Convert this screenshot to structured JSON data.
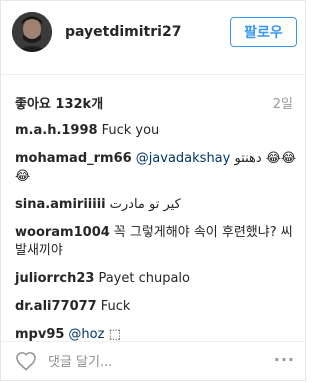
{
  "post": {
    "username": "payetdimitri27",
    "follow_label": "팔로우",
    "likes": "좋아요 132k개",
    "time": "2일"
  },
  "comments": [
    {
      "user": "m.a.h.1998",
      "text": "Fuck you"
    },
    {
      "user": "mohamad_rm66",
      "mention": "@javadakshay",
      "text": " دهنتو 😂😂😂"
    },
    {
      "user": "sina.amiriiiii",
      "text": "کیر تو مادرت"
    },
    {
      "user": "wooram1004",
      "text": "꼭 그렇게해야 속이 후련했냐? 씨발새끼야"
    },
    {
      "user": "juliorrch23",
      "text": "Payet chupalo"
    },
    {
      "user": "dr.ali77077",
      "text": "Fuck"
    },
    {
      "user": "mpv95",
      "mention": "@hoz",
      "text": " ⬚"
    }
  ],
  "footer": {
    "input_placeholder": "댓글 달기...",
    "more_label": "···"
  }
}
